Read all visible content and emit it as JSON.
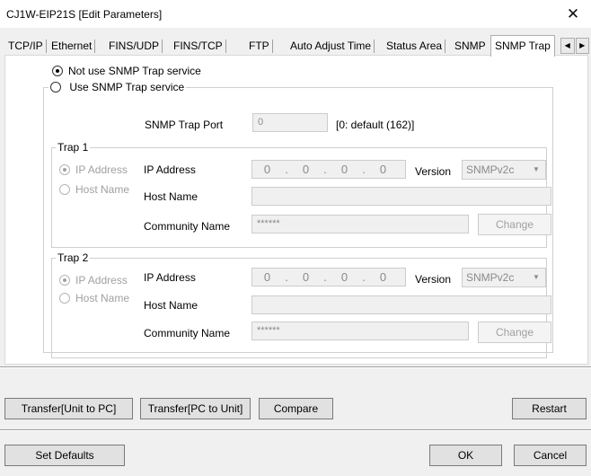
{
  "window": {
    "title": "CJ1W-EIP21S [Edit Parameters]",
    "close_glyph": "✕"
  },
  "tabs": [
    {
      "label": "TCP/IP"
    },
    {
      "label": "Ethernet"
    },
    {
      "label": "FINS/UDP"
    },
    {
      "label": "FINS/TCP"
    },
    {
      "label": "FTP"
    },
    {
      "label": "Auto Adjust Time"
    },
    {
      "label": "Status Area"
    },
    {
      "label": "SNMP"
    },
    {
      "label": "SNMP Trap"
    }
  ],
  "active_tab": "SNMP Trap",
  "tab_scroll": {
    "left": "◀",
    "right": "▶"
  },
  "service": {
    "not_use_label": "Not use SNMP Trap service",
    "use_label": "Use SNMP Trap service",
    "selected": "not_use"
  },
  "trap_port": {
    "label": "SNMP Trap Port",
    "value": "0",
    "hint": "[0: default (162)]"
  },
  "traps": [
    {
      "title": "Trap 1",
      "mode_ip_label": "IP Address",
      "mode_host_label": "Host Name",
      "mode_selected": "ip",
      "ip_label": "IP Address",
      "ip_octets": [
        "0",
        "0",
        "0",
        "0"
      ],
      "ip_dot": ".",
      "version_label": "Version",
      "version_value": "SNMPv2c",
      "host_label": "Host Name",
      "host_value": "",
      "community_label": "Community Name",
      "community_value": "******",
      "change_label": "Change"
    },
    {
      "title": "Trap 2",
      "mode_ip_label": "IP Address",
      "mode_host_label": "Host Name",
      "mode_selected": "ip",
      "ip_label": "IP Address",
      "ip_octets": [
        "0",
        "0",
        "0",
        "0"
      ],
      "ip_dot": ".",
      "version_label": "Version",
      "version_value": "SNMPv2c",
      "host_label": "Host Name",
      "host_value": "",
      "community_label": "Community Name",
      "community_value": "******",
      "change_label": "Change"
    }
  ],
  "dropdown_glyph": "▼",
  "buttons": {
    "transfer_unit_to_pc": "Transfer[Unit to PC]",
    "transfer_pc_to_unit": "Transfer[PC to Unit]",
    "compare": "Compare",
    "restart": "Restart",
    "set_defaults": "Set Defaults",
    "ok": "OK",
    "cancel": "Cancel"
  }
}
